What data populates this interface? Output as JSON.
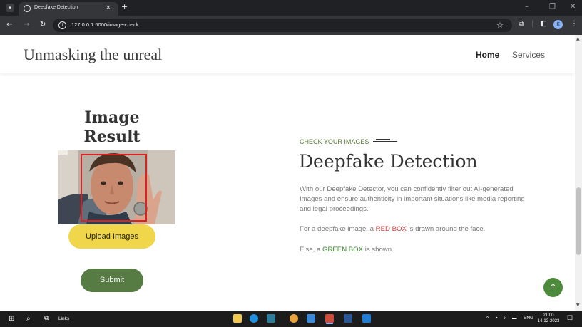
{
  "browser": {
    "tab_title": "Deepfake Detection",
    "tab_close": "×",
    "new_tab": "+",
    "url": "127.0.0.1:5000/image-check",
    "profile_initial": "K",
    "window_minimize": "–",
    "window_maximize": "❐",
    "window_close": "✕"
  },
  "header": {
    "brand": "Unmasking the unreal",
    "nav": [
      {
        "label": "Home",
        "active": true
      },
      {
        "label": "Services",
        "active": false
      }
    ]
  },
  "left": {
    "title_line1": "Image",
    "title_line2": "Result",
    "upload_label": "Upload Images",
    "submit_label": "Submit"
  },
  "right": {
    "eyebrow": "CHECK YOUR IMAGES",
    "title": "Deepfake Detection",
    "description": "With our Deepfake Detector, you can confidently filter out AI-generated Images and ensure authenticity in important situations like media reporting and legal proceedings.",
    "red_prefix": "For a deepfake image, a ",
    "red_highlight": "RED BOX",
    "red_suffix": " is drawn around the face.",
    "green_prefix": "Else, a ",
    "green_highlight": "GREEN BOX",
    "green_suffix": " is shown."
  },
  "back_to_top": "↑",
  "taskbar": {
    "search_text": "Links",
    "language": "ENG",
    "time": "21:00",
    "date": "14-12-2023"
  },
  "colors": {
    "accent_green": "#567b43",
    "upload_yellow": "#efd64a",
    "detection_box": "#e02020"
  }
}
